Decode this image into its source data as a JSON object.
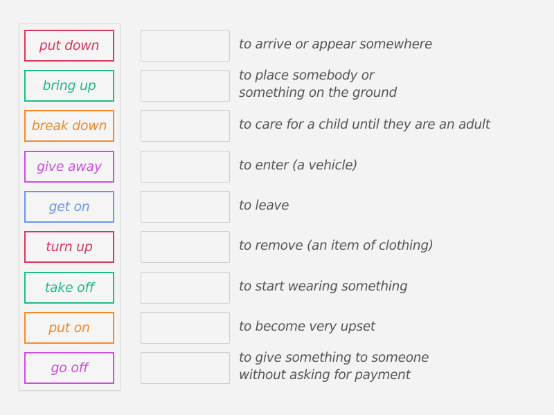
{
  "activity": {
    "type": "match-up",
    "tiles": [
      {
        "label": "put down",
        "color": "#d8365a"
      },
      {
        "label": "bring up",
        "color": "#1dbb86"
      },
      {
        "label": "break down",
        "color": "#f28a2a"
      },
      {
        "label": "give away",
        "color": "#c94fdc"
      },
      {
        "label": "get on",
        "color": "#6e95ea"
      },
      {
        "label": "turn up",
        "color": "#d8365a"
      },
      {
        "label": "take off",
        "color": "#1dbb86"
      },
      {
        "label": "put on",
        "color": "#f28a2a"
      },
      {
        "label": "go off",
        "color": "#c94fdc"
      }
    ],
    "slots": [
      {
        "value": ""
      },
      {
        "value": ""
      },
      {
        "value": ""
      },
      {
        "value": ""
      },
      {
        "value": ""
      },
      {
        "value": ""
      },
      {
        "value": ""
      },
      {
        "value": ""
      },
      {
        "value": ""
      }
    ],
    "definitions": [
      "to arrive or appear somewhere",
      "to place somebody or\nsomething on the ground",
      "to care for a child until they are an adult",
      "to enter (a vehicle)",
      "to leave",
      "to remove (an item of clothing)",
      "to start wearing something",
      "to become very upset",
      "to give something to someone\nwithout asking for payment"
    ]
  }
}
